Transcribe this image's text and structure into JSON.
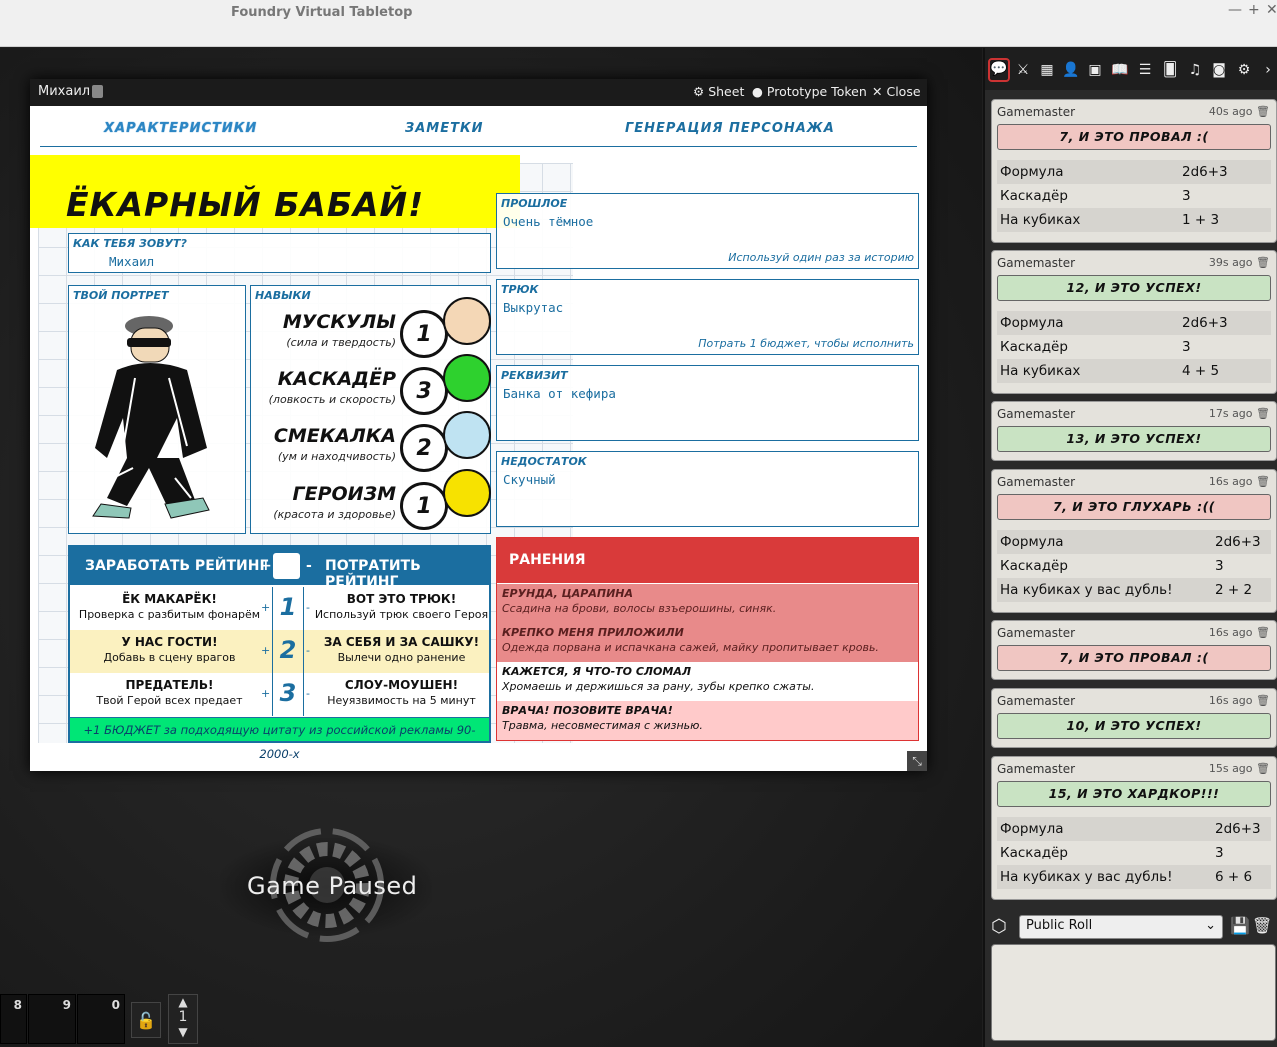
{
  "window": {
    "title": "Foundry Virtual Tabletop",
    "controls": [
      "—",
      "+",
      "✕"
    ]
  },
  "sheet": {
    "name": "Михаил",
    "buttons": {
      "sheet": "Sheet",
      "token": "Prototype Token",
      "close": "Close"
    },
    "tabs": [
      "ХАРАКТЕРИСТИКИ",
      "ЗАМЕТКИ",
      "ГЕНЕРАЦИЯ ПЕРСОНАЖА"
    ],
    "banner": "ЁКАРНЫЙ БАБАЙ!",
    "name_field": {
      "label": "КАК ТЕБЯ ЗОВУТ?",
      "value": "Михаил"
    },
    "portrait_label": "ТВОЙ ПОРТРЕТ",
    "skills_label": "НАВЫКИ",
    "skills": [
      {
        "name": "МУСКУЛЫ",
        "sub": "(сила и твердость)",
        "value": "1",
        "color": "#f4d7b6"
      },
      {
        "name": "КАСКАДЁР",
        "sub": "(ловкость и скорость)",
        "value": "3",
        "color": "#2ed12e"
      },
      {
        "name": "СМЕКАЛКА",
        "sub": "(ум и находчивость)",
        "value": "2",
        "color": "#bfe3f2"
      },
      {
        "name": "ГЕРОИЗМ",
        "sub": "(красота и здоровье)",
        "value": "1",
        "color": "#f7e200"
      }
    ],
    "past": {
      "label": "ПРОШЛОЕ",
      "value": "Очень тёмное",
      "hint": "Используй один раз за историю"
    },
    "trick": {
      "label": "ТРЮК",
      "value": "Выкрутас",
      "hint": "Потрать 1 бюджет, чтобы исполнить"
    },
    "prop": {
      "label": "РЕКВИЗИТ",
      "value": "Банка от кефира"
    },
    "flaw": {
      "label": "НЕДОСТАТОК",
      "value": "Скучный"
    },
    "rating": {
      "earn": "ЗАРАБОТАТЬ РЕЙТИНГ",
      "spend": "ПОТРАТИТЬ РЕЙТИНГ",
      "plus": "+",
      "minus": "-",
      "rows": [
        {
          "lt": "ЁК МАКАРЁК!",
          "ls": "Проверка с разбитым фонарём",
          "n": "1",
          "rt": "ВОТ ЭТО ТРЮК!",
          "rs": "Используй трюк своего Героя"
        },
        {
          "lt": "У НАС ГОСТИ!",
          "ls": "Добавь в сцену врагов",
          "n": "2",
          "rt": "ЗА СЕБЯ И ЗА САШКУ!",
          "rs": "Вылечи одно ранение"
        },
        {
          "lt": "ПРЕДАТЕЛЬ!",
          "ls": "Твой Герой всех предает",
          "n": "3",
          "rt": "СЛОУ-МОУШЕН!",
          "rs": "Неуязвимость на 5 минут"
        }
      ],
      "budget": "+1 БЮДЖЕТ за подходящую цитату из российской рекламы 90-2000-х"
    },
    "wounds": {
      "title": "РАНЕНИЯ",
      "rows": [
        {
          "t": "ЕРУНДА, ЦАРАПИНА",
          "d": "Ссадина на брови, волосы взъерошины, синяк."
        },
        {
          "t": "КРЕПКО МЕНЯ ПРИЛОЖИЛИ",
          "d": "Одежда порвана и испачкана сажей, майку пропитывает кровь."
        },
        {
          "t": "КАЖЕТСЯ, Я ЧТО-ТО СЛОМАЛ",
          "d": "Хромаешь и держишься за рану, зубы крепко сжаты."
        },
        {
          "t": "ВРАЧА! ПОЗОВИТЕ ВРАЧА!",
          "d": "Травма, несовместимая с жизнью."
        }
      ]
    }
  },
  "paused": "Game Paused",
  "hotbar": {
    "slots": [
      "8",
      "9",
      "0"
    ],
    "page": "1"
  },
  "chat": {
    "messages": [
      {
        "sender": "Gamemaster",
        "time": "40s ago",
        "result": "7, И ЭТО ПРОВАЛ :(",
        "type": "fail",
        "lines": [
          [
            "Формула",
            "2d6+3"
          ],
          [
            "Каскадёр",
            "3"
          ],
          [
            "На кубиках",
            "1 + 3"
          ]
        ]
      },
      {
        "sender": "Gamemaster",
        "time": "39s ago",
        "result": "12, И ЭТО УСПЕХ!",
        "type": "ok",
        "lines": [
          [
            "Формула",
            "2d6+3"
          ],
          [
            "Каскадёр",
            "3"
          ],
          [
            "На кубиках",
            "4 + 5"
          ]
        ]
      },
      {
        "sender": "Gamemaster",
        "time": "17s ago",
        "result": "13, И ЭТО УСПЕХ!",
        "type": "ok",
        "lines": []
      },
      {
        "sender": "Gamemaster",
        "time": "16s ago",
        "result": "7, И ЭТО ГЛУХАРЬ :((",
        "type": "fail",
        "lines": [
          [
            "Формула",
            "2d6+3"
          ],
          [
            "Каскадёр",
            "3"
          ],
          [
            "На кубиках у вас дубль!",
            "2 + 2"
          ]
        ]
      },
      {
        "sender": "Gamemaster",
        "time": "16s ago",
        "result": "7, И ЭТО ПРОВАЛ :(",
        "type": "fail",
        "lines": []
      },
      {
        "sender": "Gamemaster",
        "time": "16s ago",
        "result": "10, И ЭТО УСПЕХ!",
        "type": "ok",
        "lines": []
      },
      {
        "sender": "Gamemaster",
        "time": "15s ago",
        "result": "15, И ЭТО ХАРДКОР!!!",
        "type": "ok",
        "lines": [
          [
            "Формула",
            "2d6+3"
          ],
          [
            "Каскадёр",
            "3"
          ],
          [
            "На кубиках у вас дубль!",
            "6 + 6"
          ]
        ]
      }
    ],
    "roll_mode": "Public Roll"
  }
}
